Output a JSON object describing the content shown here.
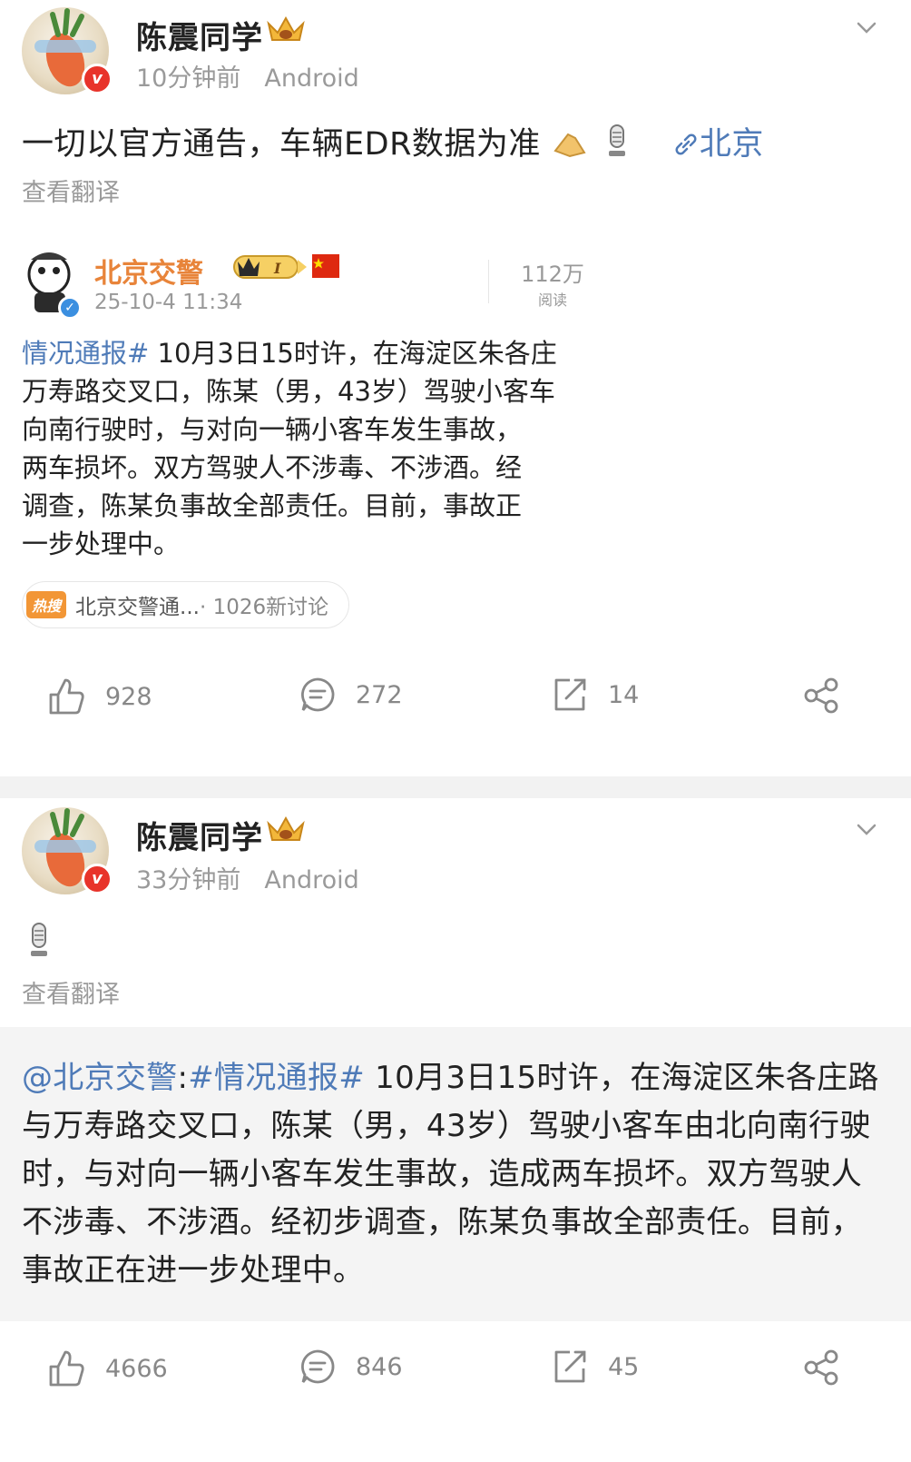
{
  "post1": {
    "author": "陈震同学",
    "time": "10分钟前",
    "device": "Android",
    "text": "一切以官方通告，车辆EDR数据为准",
    "location": "北京",
    "translate": "查看翻译",
    "quote": {
      "author": "北京交警",
      "time": "25-10-4 11:34",
      "reads_number": "112万",
      "reads_unit": "阅读",
      "tag": "情况通报#",
      "lines": [
        " 10月3日15时许，在海淀区朱各庄",
        "万寿路交叉口，陈某（男，43岁）驾驶小客车",
        "向南行驶时，与对向一辆小客车发生事故，",
        "两车损坏。双方驾驶人不涉毒、不涉酒。经",
        "调查，陈某负事故全部责任。目前，事故正",
        "一步处理中。"
      ],
      "hot_logo": "热搜",
      "hot_title": "北京交警通...",
      "hot_count": " · 1026新讨论"
    },
    "likes": "928",
    "comments": "272",
    "reposts": "14"
  },
  "post2": {
    "author": "陈震同学",
    "time": "33分钟前",
    "device": "Android",
    "translate": "查看翻译",
    "repost": {
      "mention": "@北京交警",
      "colon": ":",
      "tag": "#情况通报#",
      "text": " 10月3日15时许，在海淀区朱各庄路与万寿路交叉口，陈某（男，43岁）驾驶小客车由北向南行驶时，与对向一辆小客车发生事故，造成两车损坏。双方驾驶人不涉毒、不涉酒。经初步调查，陈某负事故全部责任。目前，事故正在进一步处理中。"
    },
    "likes": "4666",
    "comments": "846",
    "reposts": "45"
  },
  "icons": [
    "vip-crown-icon",
    "chevron-down-icon",
    "clap-emoji-icon",
    "microphone-emoji-icon",
    "link-icon",
    "verified-icon",
    "like-icon",
    "comment-icon",
    "repost-icon",
    "share-icon"
  ],
  "colors": {
    "link": "#4f7bb8",
    "accent": "#e8843a",
    "verified": "#e8332a",
    "muted": "#9a9a9a",
    "divider": "#f2f2f2"
  }
}
